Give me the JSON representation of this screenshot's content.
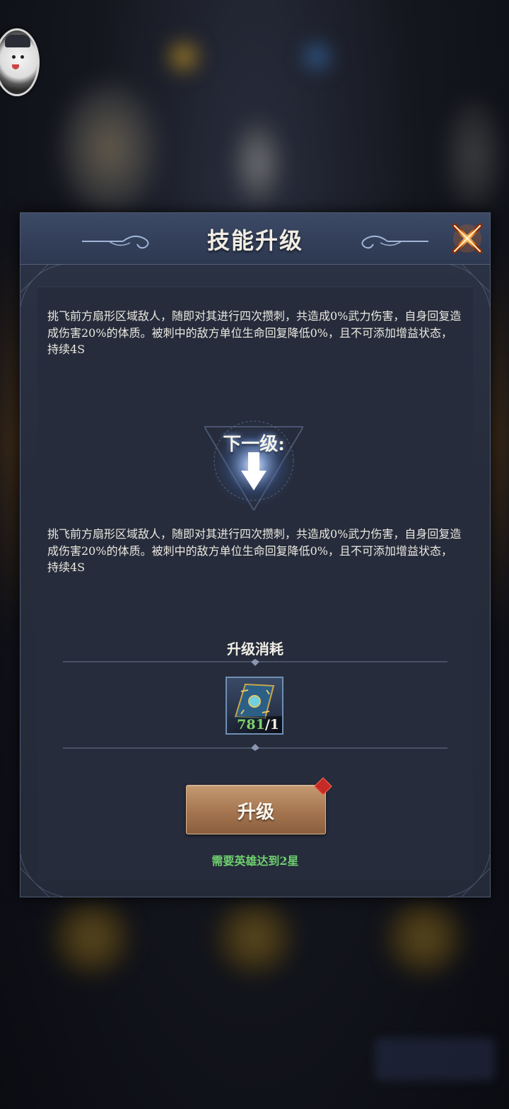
{
  "modal": {
    "title": "技能升级",
    "current_description": "挑飞前方扇形区域敌人，随即对其进行四次攒刺，共造成0%武力伤害，自身回复造成伤害20%的体质。被刺中的敌方单位生命回复降低0%，且不可添加增益状态，持续4S",
    "next_level_label": "下一级:",
    "next_description": "挑飞前方扇形区域敌人，随即对其进行四次攒刺，共造成0%武力伤害，自身回复造成伤害20%的体质。被刺中的敌方单位生命回复降低0%，且不可添加增益状态，持续4S",
    "cost": {
      "title": "升级消耗",
      "item_icon": "skill-book-icon",
      "owned": "781",
      "required": "/1"
    },
    "upgrade_button_label": "升级",
    "requirement_text": "需要英雄达到2星"
  },
  "colors": {
    "owned_count": "#7fd16a",
    "requirement_text": "#6fd06e",
    "button_bronze": "#a57550",
    "notification_dot": "#c52a24"
  }
}
